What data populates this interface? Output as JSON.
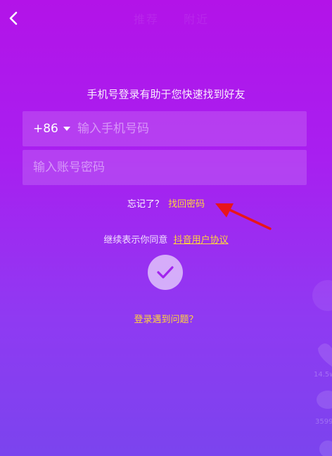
{
  "header": {
    "ghost_tabs": [
      "推荐",
      "附近"
    ]
  },
  "hint": "手机号登录有助于您快速找到好友",
  "phone": {
    "country_code": "+86",
    "placeholder": "输入手机号码"
  },
  "password": {
    "placeholder": "输入账号密码"
  },
  "forgot": {
    "prefix": "忘记了？",
    "link": "找回密码"
  },
  "agreement": {
    "prefix": "继续表示你同意",
    "link": "抖音用户协议"
  },
  "problem_link": "登录遇到问题？",
  "side": {
    "like_count": "14.5w",
    "comment_count": "3599"
  },
  "colors": {
    "accent": "#ffd43b",
    "annotation_arrow": "#e8151b"
  }
}
